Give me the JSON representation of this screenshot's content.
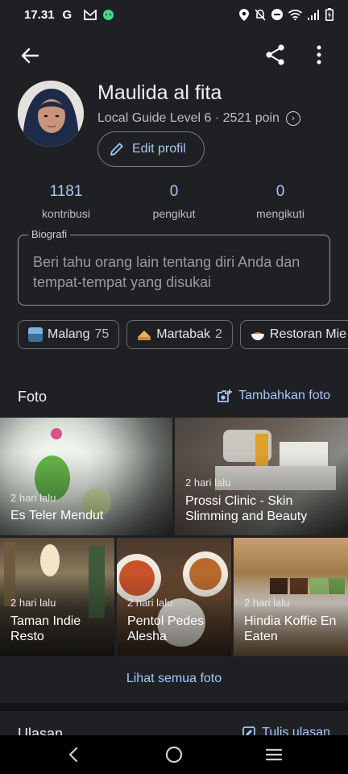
{
  "status_bar": {
    "time": "17.31",
    "left_icons": [
      "google-g-icon",
      "gmail-icon",
      "android-icon"
    ],
    "right_icons": [
      "location-icon",
      "mute-icon",
      "dnd-icon",
      "wifi-icon",
      "signal-icon",
      "battery-icon"
    ]
  },
  "profile": {
    "name": "Maulida al fita",
    "level": "Local Guide Level 6 · 2521 poin",
    "edit_label": "Edit profil"
  },
  "stats": [
    {
      "value": "1181",
      "label": "kontribusi"
    },
    {
      "value": "0",
      "label": "pengikut"
    },
    {
      "value": "0",
      "label": "mengikuti"
    }
  ],
  "bio": {
    "legend": "Biografi",
    "placeholder": "Beri tahu orang lain tentang diri Anda dan tempat-tempat yang disukai"
  },
  "chips": [
    {
      "label": "Malang",
      "count": "75",
      "icon": "city-icon"
    },
    {
      "label": "Martabak",
      "count": "2",
      "icon": "martabak-icon"
    },
    {
      "label": "Restoran Mie",
      "count": "",
      "icon": "noodle-bowl-icon"
    }
  ],
  "photos_section": {
    "title": "Foto",
    "action": "Tambahkan foto",
    "photos": [
      {
        "when": "2 hari lalu",
        "name": "Es Teler Mendut"
      },
      {
        "when": "2 hari lalu",
        "name": "Prossi Clinic - Skin Slimming and Beauty"
      },
      {
        "when": "2 hari lalu",
        "name": "Taman Indie Resto"
      },
      {
        "when": "2 hari lalu",
        "name": "Pentol Pedes Alesha"
      },
      {
        "when": "2 hari lalu",
        "name": "Hindia Koffie En Eaten"
      }
    ],
    "see_all": "Lihat semua foto"
  },
  "reviews_section": {
    "title": "Ulasan",
    "action": "Tulis ulasan"
  },
  "colors": {
    "background": "#1f2023",
    "accent": "#a8c7fa",
    "text": "#e3e3e3"
  }
}
